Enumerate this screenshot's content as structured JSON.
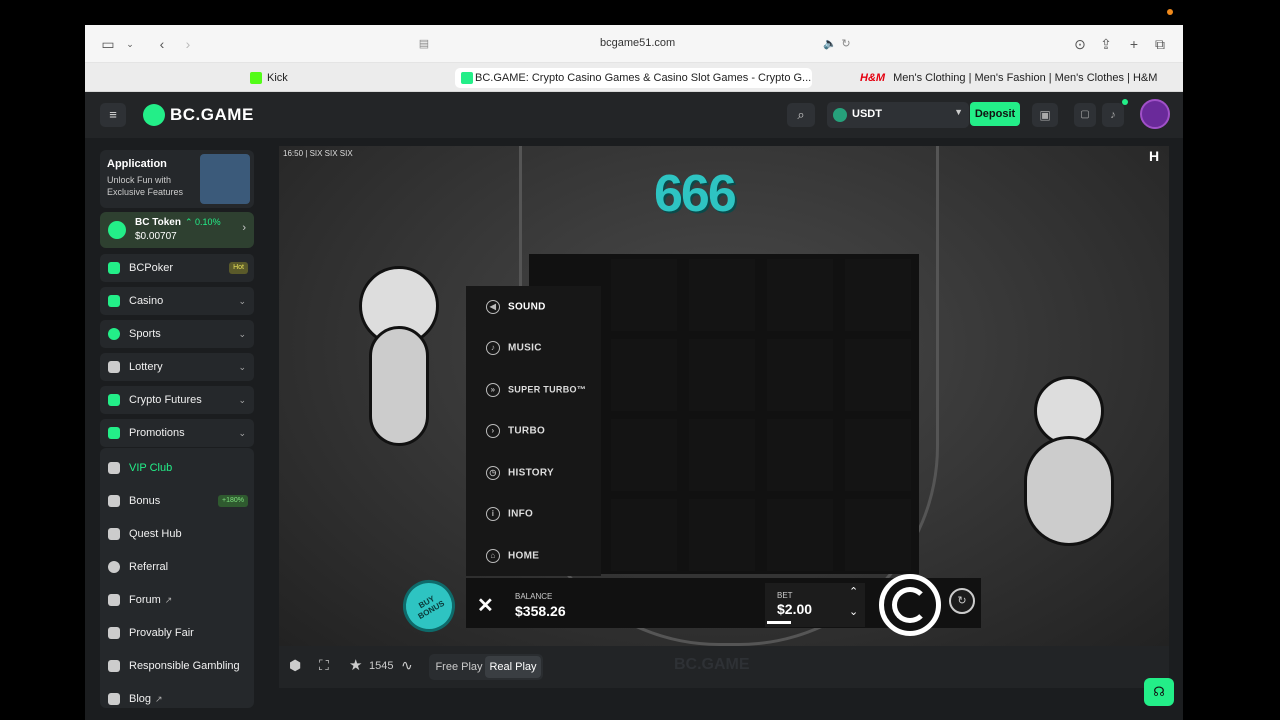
{
  "browser": {
    "url": "bcgame51.com",
    "tabs": [
      {
        "label": "Kick"
      },
      {
        "label": "BC.GAME: Crypto Casino Games & Casino Slot Games - Crypto G..."
      },
      {
        "label": "Men's Clothing | Men's Fashion | Men's Clothes | H&M IN"
      }
    ]
  },
  "header": {
    "logo": "BC.GAME",
    "currency": "USDT",
    "deposit_label": "Deposit"
  },
  "sidebar": {
    "promo": {
      "title": "Application",
      "subtitle": "Unlock Fun with Exclusive Features"
    },
    "token": {
      "name": "BC Token",
      "change": "0.10%",
      "price": "$0.00707"
    },
    "items": [
      {
        "label": "BCPoker",
        "badge": "Hot"
      },
      {
        "label": "Casino"
      },
      {
        "label": "Sports"
      },
      {
        "label": "Lottery"
      },
      {
        "label": "Crypto Futures"
      },
      {
        "label": "Promotions"
      },
      {
        "label": "VIP Club"
      },
      {
        "label": "Bonus",
        "badge": "+180%"
      },
      {
        "label": "Quest Hub"
      },
      {
        "label": "Referral"
      },
      {
        "label": "Forum"
      },
      {
        "label": "Provably Fair"
      },
      {
        "label": "Responsible Gambling"
      },
      {
        "label": "Blog"
      }
    ]
  },
  "game": {
    "clock": "16:50",
    "title": "SIX SIX SIX",
    "logo_text": "666",
    "menu": [
      "SOUND",
      "MUSIC",
      "SUPER TURBO™",
      "TURBO",
      "HISTORY",
      "INFO",
      "HOME"
    ],
    "buy_bonus": "BUY BONUS",
    "balance_label": "BALANCE",
    "balance": "$358.26",
    "bet_label": "BET",
    "bet": "$2.00"
  },
  "controls": {
    "favorites": "1545",
    "free_play": "Free Play",
    "real_play": "Real Play"
  },
  "colors": {
    "accent": "#23ee88",
    "teal": "#2ec4c2"
  }
}
